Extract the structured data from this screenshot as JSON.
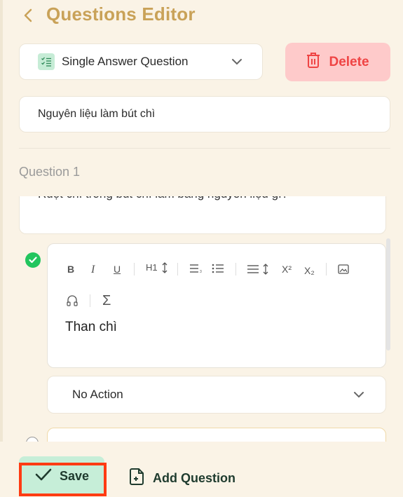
{
  "header": {
    "title": "Questions Editor"
  },
  "question_type": {
    "selected": "Single Answer Question",
    "icon": "checklist-icon"
  },
  "delete_button": {
    "label": "Delete"
  },
  "quiz_name": {
    "value": "Nguyên liệu làm bút chì"
  },
  "question": {
    "label": "Question 1",
    "text": "Ruột chì trong bút chì làm bằng nguyên liệu gì?"
  },
  "answer": {
    "text": "Than chì",
    "correct": true,
    "toolbar": {
      "bold": "B",
      "italic": "I",
      "underline": "U",
      "heading": "H1",
      "superscript": "X²",
      "subscript": "X₂",
      "formula": "Σ"
    },
    "action": {
      "selected": "No Action"
    }
  },
  "footer": {
    "save_label": "Save",
    "add_question_label": "Add Question"
  },
  "colors": {
    "title": "#c9a258",
    "delete_bg": "#fecaca",
    "delete_text": "#ef4444",
    "save_bg": "#c6eed8",
    "highlight": "#ff3b12",
    "correct": "#22c55e"
  }
}
